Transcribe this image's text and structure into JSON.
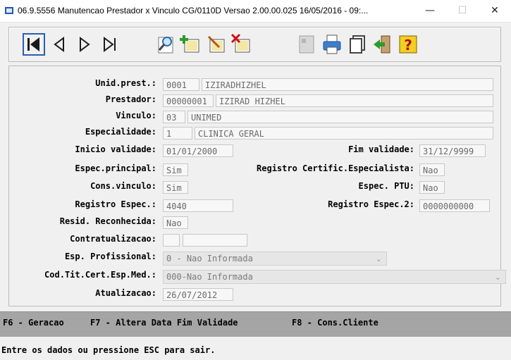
{
  "window": {
    "title": "06.9.5556 Manutencao  Prestador x Vinculo CG/0110D Versao 2.00.00.025 16/05/2016 - 09:...",
    "minimize": "—",
    "maximize": "☐",
    "close": "✕"
  },
  "toolbar": {
    "buttons": [
      "first-record",
      "previous-record",
      "next-record",
      "last-record",
      "search",
      "add",
      "edit",
      "delete",
      "print-disabled",
      "print",
      "copy",
      "exit",
      "help"
    ]
  },
  "form": {
    "unid_prest": {
      "label": "Unid.prest.:",
      "code": "0001",
      "name": "IZIRADHIZHEL"
    },
    "prestador": {
      "label": "Prestador:",
      "code": "00000001",
      "name": "IZIRAD HIZHEL"
    },
    "vinculo": {
      "label": "Vinculo:",
      "code": "03",
      "name": "UNIMED"
    },
    "especialidade": {
      "label": "Especialidade:",
      "code": "1",
      "name": "CLINICA GERAL"
    },
    "inicio_validade": {
      "label": "Inicio validade:",
      "value": "01/01/2000"
    },
    "fim_validade": {
      "label": "Fim validade:",
      "value": "31/12/9999"
    },
    "espec_principal": {
      "label": "Espec.principal:",
      "value": "Sim"
    },
    "registro_certific": {
      "label": "Registro Certific.Especialista:",
      "value": "Nao"
    },
    "cons_vinculo": {
      "label": "Cons.vinculo:",
      "value": "Sim"
    },
    "espec_ptu": {
      "label": "Espec. PTU:",
      "value": "Nao"
    },
    "registro_espec": {
      "label": "Registro Espec.:",
      "value": "4040"
    },
    "registro_espec2": {
      "label": "Registro Espec.2:",
      "value": "0000000000"
    },
    "resid_reconhecida": {
      "label": "Resid. Reconhecida:",
      "value": "Nao"
    },
    "contratualizacao": {
      "label": "Contratualizacao:",
      "value1": "",
      "value2": ""
    },
    "esp_profissional": {
      "label": "Esp. Profissional:",
      "value": "0 - Nao Informada"
    },
    "cod_tit_cert": {
      "label": "Cod.Tit.Cert.Esp.Med.:",
      "value": "000-Nao Informada"
    },
    "atualizacao": {
      "label": "Atualizacao:",
      "value": "26/07/2012"
    }
  },
  "fkeys": {
    "f6": "F6 - Geracao",
    "f7": "F7 - Altera Data Fim Validade",
    "f8": "F8 - Cons.Cliente"
  },
  "status": "Entre os dados ou pressione ESC para sair."
}
